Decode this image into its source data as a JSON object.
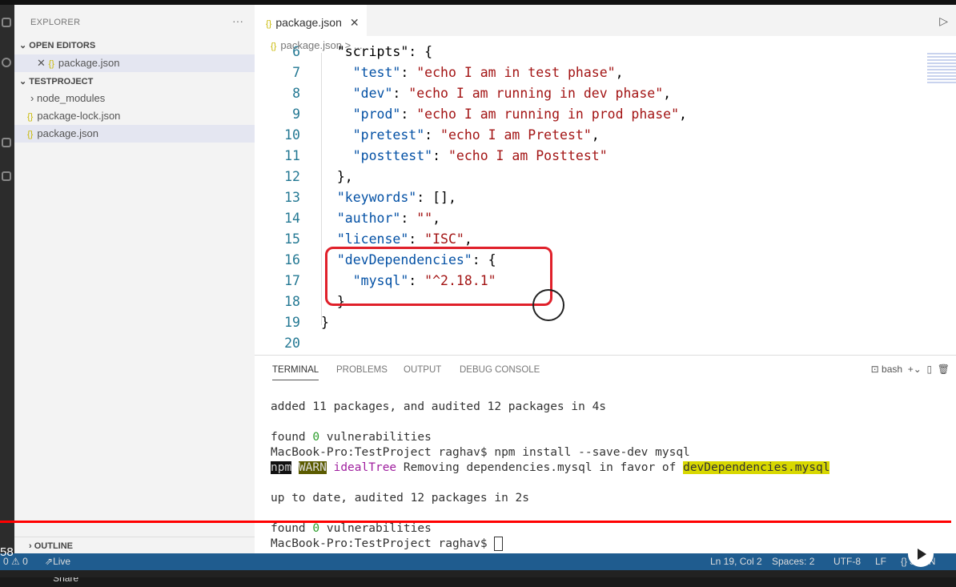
{
  "sidebar": {
    "title": "EXPLORER",
    "more": "···",
    "open_editors": "OPEN EDITORS",
    "open_file": "package.json",
    "project": "TESTPROJECT",
    "items": [
      "node_modules",
      "package-lock.json",
      "package.json"
    ],
    "outline": "OUTLINE"
  },
  "editor": {
    "tab": "package.json",
    "breadcrumb": "package.json > ...",
    "lines": [
      {
        "n": "6",
        "t": "  \"scripts\": {"
      },
      {
        "n": "7",
        "k": "    \"test\"",
        "v": "\"echo I am in test phase\"",
        "e": ","
      },
      {
        "n": "8",
        "k": "    \"dev\"",
        "v": "\"echo I am running in dev phase\"",
        "e": ","
      },
      {
        "n": "9",
        "k": "    \"prod\"",
        "v": "\"echo I am running in prod phase\"",
        "e": ","
      },
      {
        "n": "10",
        "k": "    \"pretest\"",
        "v": "\"echo I am Pretest\"",
        "e": ","
      },
      {
        "n": "11",
        "k": "    \"posttest\"",
        "v": "\"echo I am Posttest\"",
        "e": ""
      },
      {
        "n": "12",
        "t": "  },"
      },
      {
        "n": "13",
        "k": "  \"keywords\"",
        "t2": ": [],"
      },
      {
        "n": "14",
        "k": "  \"author\"",
        "v": "\"\"",
        "e": ","
      },
      {
        "n": "15",
        "k": "  \"license\"",
        "v": "\"ISC\"",
        "e": ","
      },
      {
        "n": "16",
        "k": "  \"devDependencies\"",
        "t2": ": {"
      },
      {
        "n": "17",
        "k": "    \"mysql\"",
        "v": "\"^2.18.1\"",
        "e": ""
      },
      {
        "n": "18",
        "t": "  }"
      },
      {
        "n": "19",
        "t": "}"
      },
      {
        "n": "20",
        "t": ""
      }
    ]
  },
  "panel": {
    "tabs": [
      "TERMINAL",
      "PROBLEMS",
      "OUTPUT",
      "DEBUG CONSOLE"
    ],
    "shell": "bash",
    "l1": "added 11 packages, and audited 12 packages in 4s",
    "found": "found ",
    "zero": "0",
    "vuln": " vulnerabilities",
    "cmd": "MacBook-Pro:TestProject raghav$ npm install --save-dev mysql",
    "npm": "npm",
    "warn": "WARN",
    "tree": "idealTree",
    "rm": " Removing dependencies.mysql in favor of ",
    "dev": "devDependencies.mysql",
    "l5": "up to date, audited 12 packages in 2s",
    "prompt": "MacBook-Pro:TestProject raghav$ "
  },
  "status": {
    "problems": "0 ⚠ 0",
    "live": "Live Share",
    "pos": "Ln 19, Col 2",
    "spaces": "Spaces: 2",
    "enc": "UTF-8",
    "eol": "LF",
    "lang": "{} JSON"
  },
  "video": {
    "time": "58",
    "progress": 1.0
  }
}
